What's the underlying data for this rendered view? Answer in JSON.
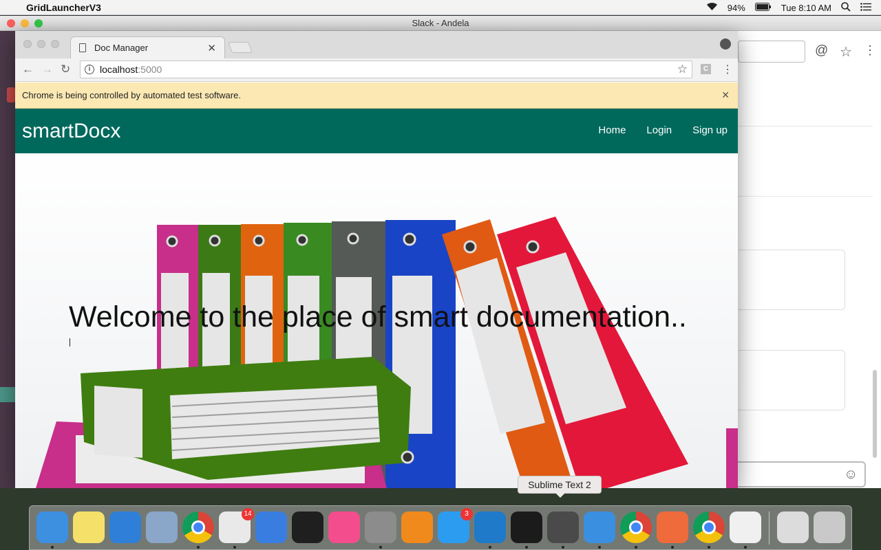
{
  "menubar": {
    "app_name": "GridLauncherV3",
    "battery": "94%",
    "clock": "Tue 8:10 AM"
  },
  "slack_window": {
    "title": "Slack - Andela"
  },
  "browser": {
    "tab_title": "Doc Manager",
    "url_host": "localhost",
    "url_port": ":5000",
    "extension_label": "C",
    "automation_notice": "Chrome is being controlled by automated test software."
  },
  "page": {
    "brand": "smartDocx",
    "nav": [
      {
        "label": "Home"
      },
      {
        "label": "Login"
      },
      {
        "label": "Sign up"
      }
    ],
    "hero_heading": "Welcome to the place of smart documentation.."
  },
  "tooltip": "Sublime Text 2",
  "dock": {
    "items": [
      {
        "name": "Finder",
        "color": "#3d8fe0",
        "running": true
      },
      {
        "name": "Notes",
        "color": "#f5e16a",
        "running": false
      },
      {
        "name": "Safari",
        "color": "#2f7fd8",
        "running": false
      },
      {
        "name": "Mail",
        "color": "#8aa6c8",
        "running": false
      },
      {
        "name": "Chrome",
        "color": "#ffffff",
        "running": true
      },
      {
        "name": "Slack",
        "color": "#e9e9e9",
        "running": true,
        "badge": "14"
      },
      {
        "name": "Keynote",
        "color": "#3a7de0",
        "running": false
      },
      {
        "name": "Terminal",
        "color": "#1f1f1f",
        "running": false
      },
      {
        "name": "iTunes",
        "color": "#f44d8e",
        "running": false
      },
      {
        "name": "System Preferences",
        "color": "#8c8c8c",
        "running": true
      },
      {
        "name": "iBooks",
        "color": "#f08a1d",
        "running": false
      },
      {
        "name": "App Store",
        "color": "#2c9cf0",
        "running": false,
        "badge": "3"
      },
      {
        "name": "Visual Studio Code",
        "color": "#1f7ac9",
        "running": true
      },
      {
        "name": "iTerm",
        "color": "#1b1b1b",
        "running": true
      },
      {
        "name": "Sublime Text 2",
        "color": "#4a4a4a",
        "running": true
      },
      {
        "name": "Sequel Pro",
        "color": "#3b8fe0",
        "running": true
      },
      {
        "name": "Chrome",
        "color": "#ffffff",
        "running": true
      },
      {
        "name": "Postman",
        "color": "#ef6b3b",
        "running": true
      },
      {
        "name": "Chrome",
        "color": "#ffffff",
        "running": true
      },
      {
        "name": "Java",
        "color": "#f0f0f0",
        "running": true
      },
      {
        "name": "Downloads",
        "color": "#dcdcdc",
        "running": false
      },
      {
        "name": "Trash",
        "color": "#c9c9c9",
        "running": false
      }
    ]
  },
  "colors": {
    "navbar": "#00695c",
    "infobar": "#fbe8b3",
    "slack_sidebar": "#4d394b"
  }
}
